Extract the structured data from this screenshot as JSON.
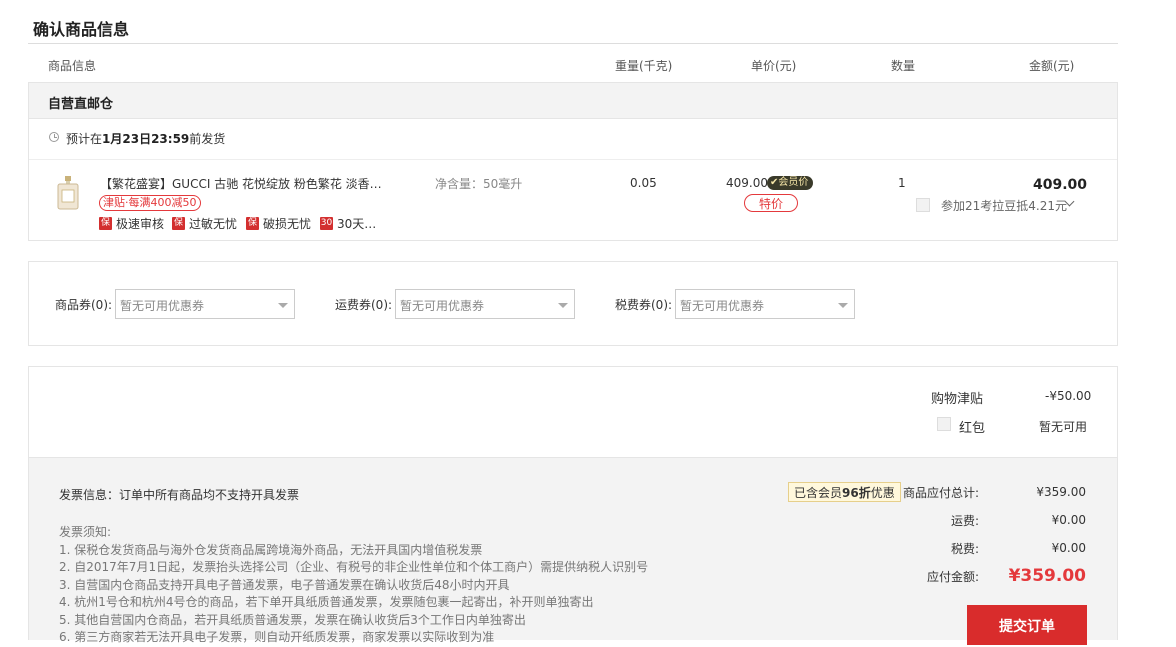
{
  "page_title": "确认商品信息",
  "columns": {
    "info": "商品信息",
    "weight": "重量(千克)",
    "unit_price": "单价(元)",
    "quantity": "数量",
    "amount": "金额(元)"
  },
  "warehouse": {
    "title": "自营直邮仓",
    "ship_prefix": "预计在",
    "ship_date": "1月23日23:59",
    "ship_suffix": "前发货"
  },
  "item": {
    "title": "【繁花盛宴】GUCCI 古驰 花悦绽放 粉色繁花 淡香…",
    "promo_tag": "津贴·每满400减50",
    "services": [
      {
        "icon": "保",
        "label": "极速审核"
      },
      {
        "icon": "保",
        "label": "过敏无忧"
      },
      {
        "icon": "保",
        "label": "破损无忧"
      },
      {
        "icon": "30",
        "label": "30天…"
      }
    ],
    "spec": "净含量：50毫升",
    "weight": "0.05",
    "price": "409.00",
    "member_badge": "会员价",
    "special_tag": "特价",
    "quantity": "1",
    "amount": "409.00",
    "bean_text": "参加21考拉豆抵4.21元"
  },
  "coupons": {
    "goods_label": "商品券(0):",
    "goods_placeholder": "暂无可用优惠券",
    "shipping_label": "运费券(0):",
    "shipping_placeholder": "暂无可用优惠券",
    "tax_label": "税费券(0):",
    "tax_placeholder": "暂无可用优惠券"
  },
  "summary": {
    "subsidy_label": "购物津贴",
    "subsidy_value": "-¥50.00",
    "red_packet_label": "红包",
    "red_packet_value": "暂无可用"
  },
  "invoice": {
    "info": "发票信息：订单中所有商品均不支持开具发票",
    "notes_title": "发票须知:",
    "notes": [
      "1. 保税仓发货商品与海外仓发货商品属跨境海外商品，无法开具国内增值税发票",
      "2. 自2017年7月1日起，发票抬头选择公司（企业、有税号的非企业性单位和个体工商户）需提供纳税人识别号",
      "3. 自营国内仓商品支持开具电子普通发票，电子普通发票在确认收货后48小时内开具",
      "4. 杭州1号仓和杭州4号仓的商品，若下单开具纸质普通发票，发票随包裹一起寄出，补开则单独寄出",
      "5. 其他自营国内仓商品，若开具纸质普通发票，发票在确认收货后3个工作日内单独寄出",
      "6. 第三方商家若无法开具电子发票，则自动开纸质发票，商家发票以实际收到为准"
    ]
  },
  "totals": {
    "discount_prefix": "已含会员",
    "discount_bold": "96折",
    "discount_suffix": "优惠",
    "goods_total_label": "商品应付总计:",
    "goods_total_value": "¥359.00",
    "shipping_label": "运费:",
    "shipping_value": "¥0.00",
    "tax_label": "税费:",
    "tax_value": "¥0.00",
    "payable_label": "应付金额:",
    "payable_value": "¥359.00"
  },
  "submit_label": "提交订单",
  "colors": {
    "accent_red": "#e4393c",
    "button_red": "#d92c2c"
  }
}
